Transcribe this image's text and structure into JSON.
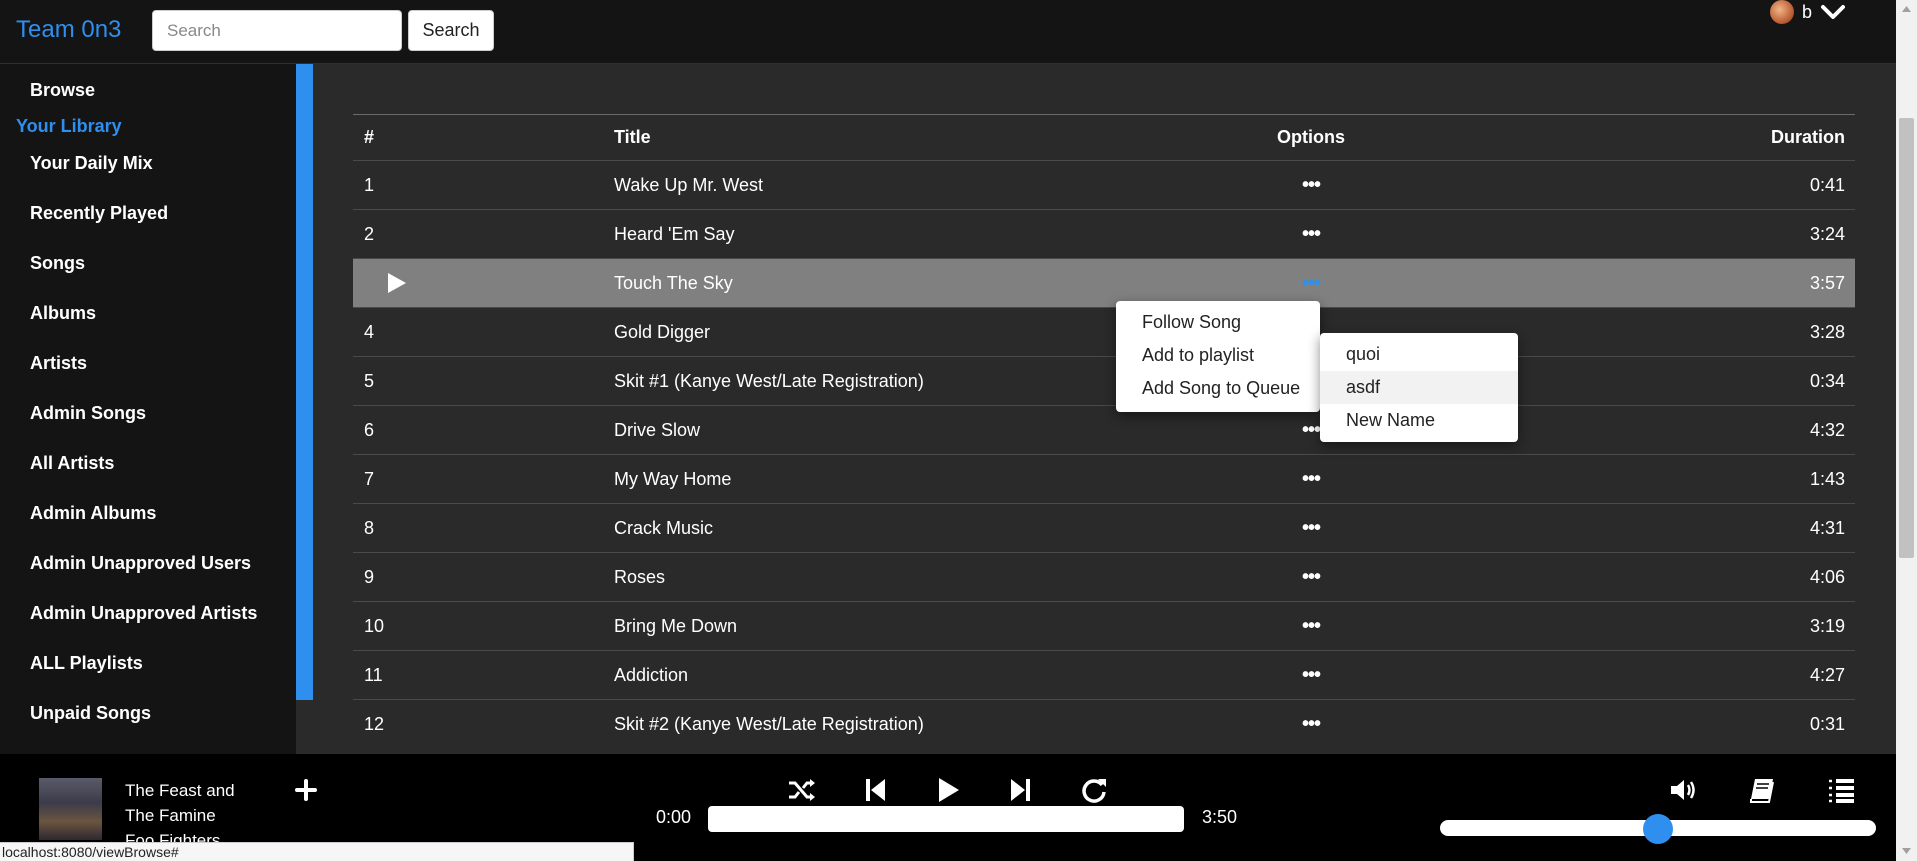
{
  "header": {
    "brand": "Team 0n3",
    "search_placeholder": "Search",
    "search_button": "Search",
    "user_name": "b"
  },
  "sidebar": {
    "items": [
      {
        "label": "Browse"
      },
      {
        "label": "Your Library",
        "heading": true
      },
      {
        "label": "Your Daily Mix"
      },
      {
        "label": "Recently Played"
      },
      {
        "label": "Songs"
      },
      {
        "label": "Albums"
      },
      {
        "label": "Artists"
      },
      {
        "label": "Admin Songs"
      },
      {
        "label": "All Artists"
      },
      {
        "label": "Admin Albums"
      },
      {
        "label": "Admin Unapproved Users"
      },
      {
        "label": "Admin Unapproved Artists"
      },
      {
        "label": "ALL Playlists"
      },
      {
        "label": "Unpaid Songs"
      }
    ]
  },
  "table": {
    "headers": {
      "num": "#",
      "title": "Title",
      "options": "Options",
      "duration": "Duration"
    },
    "rows": [
      {
        "num": "1",
        "title": "Wake Up Mr. West",
        "options": "•••",
        "duration": "0:41"
      },
      {
        "num": "2",
        "title": "Heard 'Em Say",
        "options": "•••",
        "duration": "3:24"
      },
      {
        "num": "",
        "title": "Touch The Sky",
        "options": "•••",
        "duration": "3:57",
        "selected": true
      },
      {
        "num": "4",
        "title": "Gold Digger",
        "options": "",
        "duration": "3:28"
      },
      {
        "num": "5",
        "title": "Skit #1 (Kanye West/Late Registration)",
        "options": "",
        "duration": "0:34"
      },
      {
        "num": "6",
        "title": "Drive Slow",
        "options": "•••",
        "duration": "4:32"
      },
      {
        "num": "7",
        "title": "My Way Home",
        "options": "•••",
        "duration": "1:43"
      },
      {
        "num": "8",
        "title": "Crack Music",
        "options": "•••",
        "duration": "4:31"
      },
      {
        "num": "9",
        "title": "Roses",
        "options": "•••",
        "duration": "4:06"
      },
      {
        "num": "10",
        "title": "Bring Me Down",
        "options": "•••",
        "duration": "3:19"
      },
      {
        "num": "11",
        "title": "Addiction",
        "options": "•••",
        "duration": "4:27"
      },
      {
        "num": "12",
        "title": "Skit #2 (Kanye West/Late Registration)",
        "options": "•••",
        "duration": "0:31"
      }
    ]
  },
  "context_menu": {
    "items": [
      "Follow Song",
      "Add to playlist",
      "Add Song to Queue"
    ]
  },
  "playlist_submenu": {
    "items": [
      "quoi",
      "asdf",
      "New Name"
    ],
    "hovered": "asdf"
  },
  "player": {
    "track_lines": [
      "The Feast and",
      "The Famine",
      "Foo Fighters"
    ],
    "current_time": "0:00",
    "total_time": "3:50",
    "progress": 0,
    "volume": 0.5,
    "icons": [
      "add-icon",
      "shuffle-icon",
      "previous-icon",
      "play-icon",
      "next-icon",
      "repeat-icon",
      "volume-icon",
      "lyrics-book-icon",
      "queue-list-icon"
    ]
  },
  "status_bar": {
    "url": "localhost:8080/viewBrowse#"
  },
  "colors": {
    "accent": "#2f8fef",
    "background": "#2b2a2a",
    "sidebar": "#141414",
    "selected_row": "#808080"
  }
}
